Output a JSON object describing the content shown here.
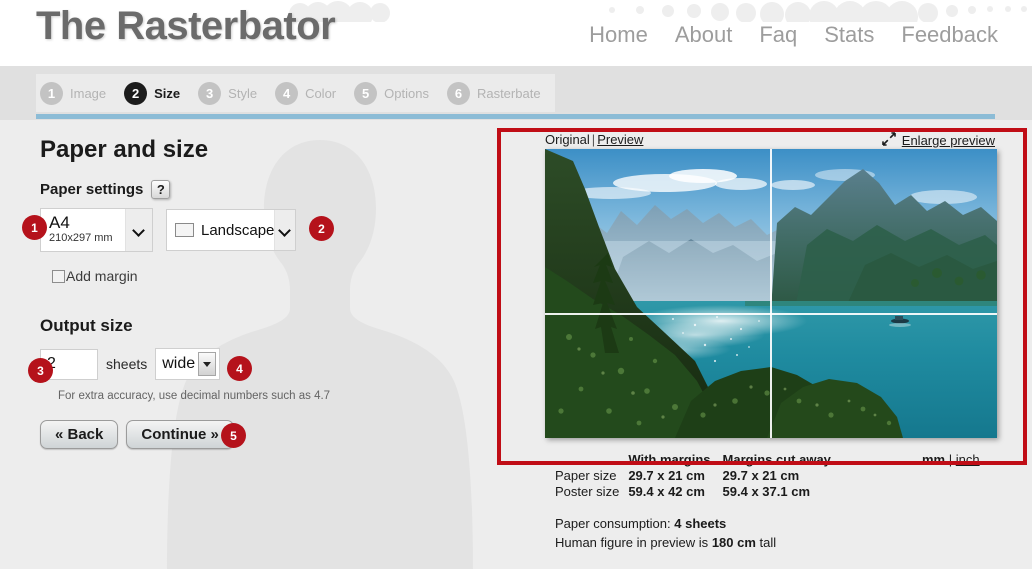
{
  "header": {
    "brand": "The Rasterbator",
    "nav": [
      {
        "label": "Home"
      },
      {
        "label": "About"
      },
      {
        "label": "Faq"
      },
      {
        "label": "Stats"
      },
      {
        "label": "Feedback"
      }
    ]
  },
  "steps": [
    {
      "num": "1",
      "label": "Image",
      "active": false
    },
    {
      "num": "2",
      "label": "Size",
      "active": true
    },
    {
      "num": "3",
      "label": "Style",
      "active": false
    },
    {
      "num": "4",
      "label": "Color",
      "active": false
    },
    {
      "num": "5",
      "label": "Options",
      "active": false
    },
    {
      "num": "6",
      "label": "Rasterbate",
      "active": false
    }
  ],
  "form": {
    "page_title": "Paper and size",
    "paper_settings_label": "Paper settings",
    "help_glyph": "?",
    "paper_size": {
      "name": "A4",
      "dimensions": "210x297 mm"
    },
    "orientation": "Landscape",
    "add_margin_label": "Add margin",
    "add_margin_checked": false,
    "output_size_label": "Output size",
    "sheets_value": "2",
    "sheets_placeholder": "",
    "sheets_word": "sheets",
    "direction": "wide",
    "hint": "For extra accuracy, use decimal numbers such as 4.7",
    "back_button": "« Back",
    "continue_button": "Continue »"
  },
  "callouts": [
    {
      "num": "1"
    },
    {
      "num": "2"
    },
    {
      "num": "3"
    },
    {
      "num": "4"
    },
    {
      "num": "5"
    }
  ],
  "preview": {
    "original_label": "Original",
    "separator": "|",
    "preview_label": "Preview",
    "enlarge_label": "Enlarge preview",
    "enlarge_icon": "diagonal-arrows-icon",
    "sheets_wide": 2,
    "sheets_tall": 2,
    "image_description": "Mountain lake landscape with forested slopes and alpine peaks"
  },
  "info": {
    "col_headers": [
      "",
      "With margins",
      "Margins cut away"
    ],
    "rows": [
      {
        "label": "Paper size",
        "with_margins": "29.7 x 21 cm",
        "cut_away": "29.7 x 21 cm"
      },
      {
        "label": "Poster size",
        "with_margins": "59.4 x 42 cm",
        "cut_away": "59.4 x 37.1 cm"
      }
    ],
    "paper_consumption_label": "Paper consumption:",
    "paper_consumption_value": "4 sheets",
    "human_figure_prefix": "Human figure in preview is",
    "human_figure_value": "180 cm",
    "human_figure_suffix": "tall",
    "unit_mm": "mm",
    "unit_sep": "|",
    "unit_inch": "inch"
  },
  "colors": {
    "accent_red": "#b5121b",
    "highlight_red": "#c00d16",
    "step_underline_blue": "#8cbcd6",
    "page_bg": "#ededed",
    "step_bar_bg": "#e0e0e0"
  }
}
